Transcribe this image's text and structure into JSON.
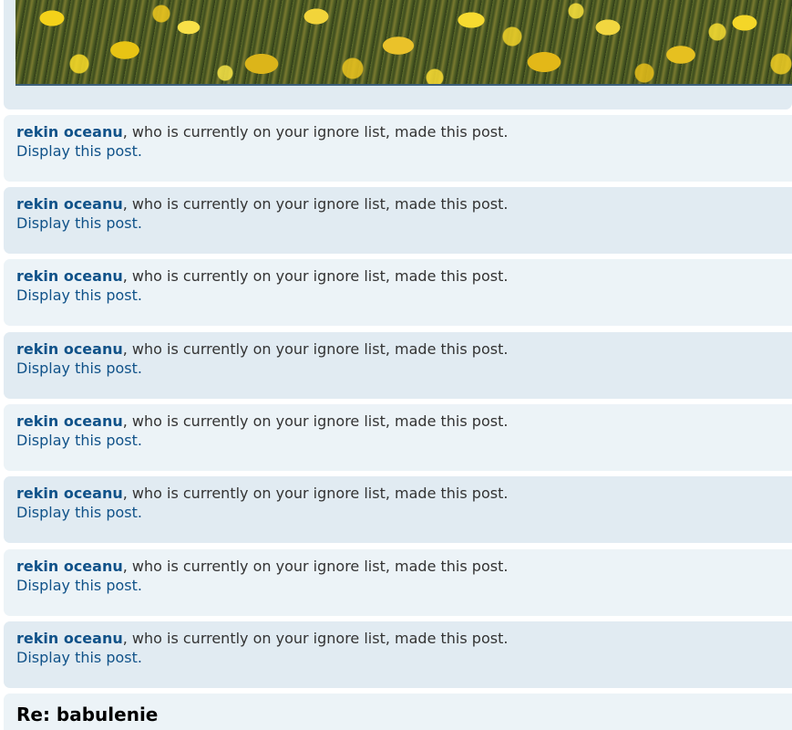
{
  "top_post": {
    "image_name": "yellow-flowers-photo"
  },
  "ignored_posts": [
    {
      "username": "rekin oceanu",
      "message": ", who is currently on your ignore list, made this post.",
      "link": "Display this post."
    },
    {
      "username": "rekin oceanu",
      "message": ", who is currently on your ignore list, made this post.",
      "link": "Display this post."
    },
    {
      "username": "rekin oceanu",
      "message": ", who is currently on your ignore list, made this post.",
      "link": "Display this post."
    },
    {
      "username": "rekin oceanu",
      "message": ", who is currently on your ignore list, made this post.",
      "link": "Display this post."
    },
    {
      "username": "rekin oceanu",
      "message": ", who is currently on your ignore list, made this post.",
      "link": "Display this post."
    },
    {
      "username": "rekin oceanu",
      "message": ", who is currently on your ignore list, made this post.",
      "link": "Display this post."
    },
    {
      "username": "rekin oceanu",
      "message": ", who is currently on your ignore list, made this post.",
      "link": "Display this post."
    },
    {
      "username": "rekin oceanu",
      "message": ", who is currently on your ignore list, made this post.",
      "link": "Display this post."
    }
  ],
  "next_post": {
    "title": "Re: babulenie"
  },
  "colors": {
    "username": "#105289",
    "post_bg_light": "#ecf3f7",
    "post_bg_dark": "#e1ebf2",
    "text": "#333333"
  }
}
